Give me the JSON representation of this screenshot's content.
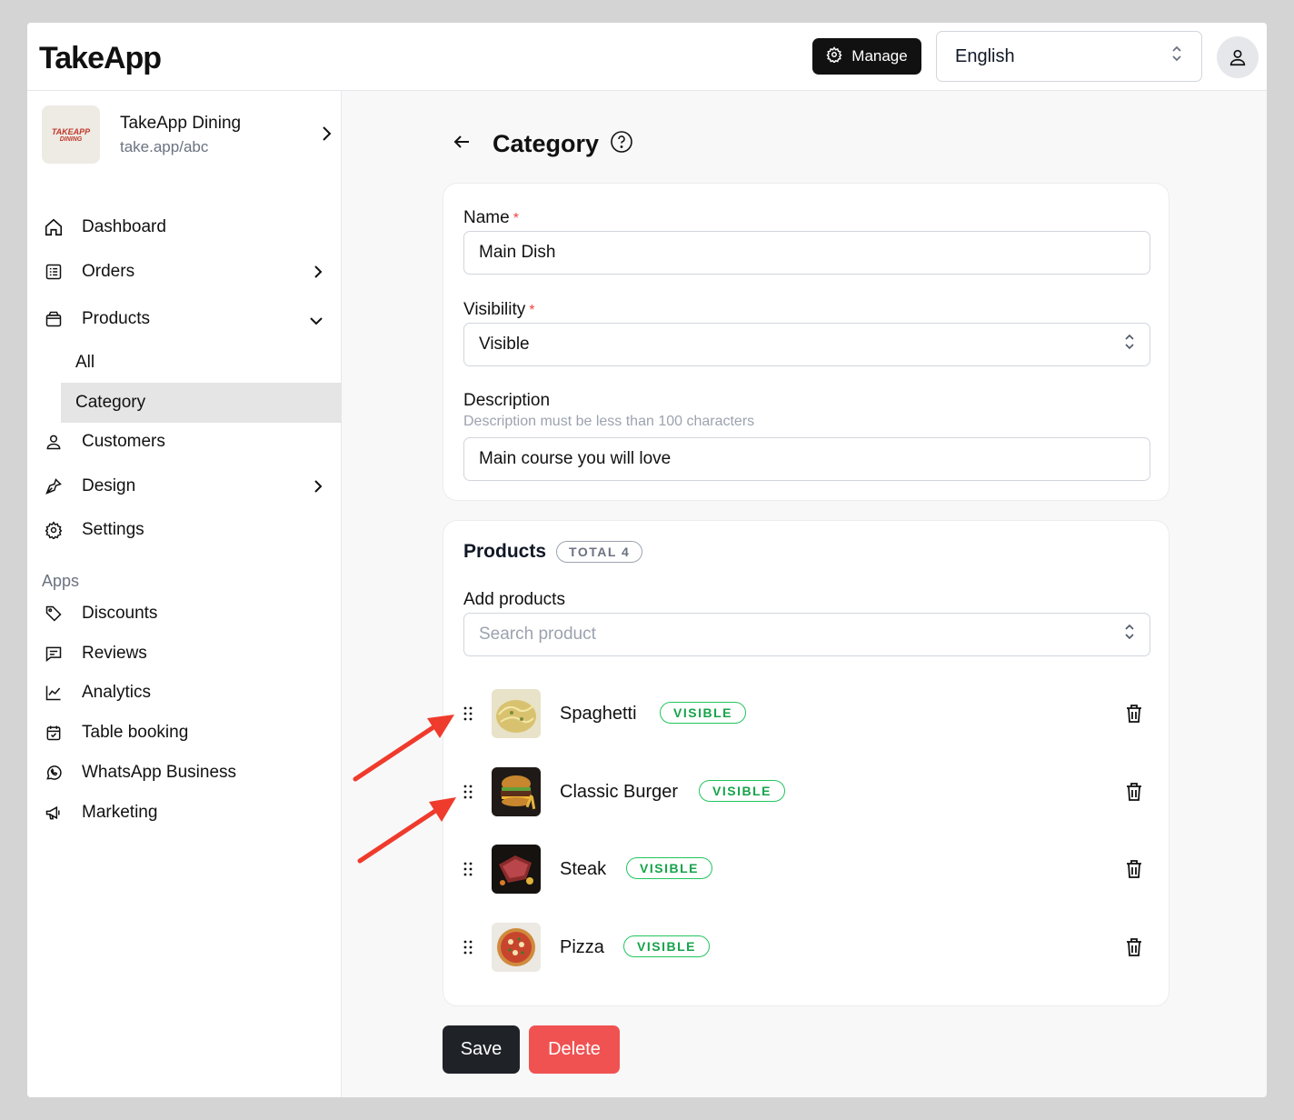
{
  "app": {
    "logo": "TakeApp"
  },
  "header": {
    "manage_label": "Manage",
    "language": "English"
  },
  "store": {
    "name": "TakeApp Dining",
    "url": "take.app/abc",
    "logo_line1": "TAKEAPP",
    "logo_line2": "DINING"
  },
  "sidebar": {
    "items": [
      {
        "label": "Dashboard",
        "icon": "home-icon"
      },
      {
        "label": "Orders",
        "icon": "list-icon"
      },
      {
        "label": "Products",
        "icon": "box-icon"
      },
      {
        "label": "Customers",
        "icon": "user-icon"
      },
      {
        "label": "Design",
        "icon": "pen-icon"
      },
      {
        "label": "Settings",
        "icon": "gear-icon"
      }
    ],
    "product_sub": [
      {
        "label": "All"
      },
      {
        "label": "Category"
      }
    ],
    "apps_label": "Apps",
    "apps": [
      {
        "label": "Discounts",
        "icon": "tag-icon"
      },
      {
        "label": "Reviews",
        "icon": "message-icon"
      },
      {
        "label": "Analytics",
        "icon": "chart-icon"
      },
      {
        "label": "Table booking",
        "icon": "calendar-icon"
      },
      {
        "label": "WhatsApp Business",
        "icon": "whatsapp-icon"
      },
      {
        "label": "Marketing",
        "icon": "megaphone-icon"
      }
    ]
  },
  "page": {
    "title": "Category"
  },
  "form": {
    "name_label": "Name",
    "name_value": "Main Dish",
    "visibility_label": "Visibility",
    "visibility_value": "Visible",
    "description_label": "Description",
    "description_hint": "Description must be less than 100 characters",
    "description_value": "Main course you will love",
    "required_mark": "*"
  },
  "products": {
    "title": "Products",
    "total_badge": "TOTAL 4",
    "add_label": "Add products",
    "search_placeholder": "Search product",
    "items": [
      {
        "name": "Spaghetti",
        "status": "VISIBLE"
      },
      {
        "name": "Classic Burger",
        "status": "VISIBLE"
      },
      {
        "name": "Steak",
        "status": "VISIBLE"
      },
      {
        "name": "Pizza",
        "status": "VISIBLE"
      }
    ]
  },
  "actions": {
    "save": "Save",
    "delete": "Delete"
  },
  "colors": {
    "accent_dark": "#111111",
    "danger": "#f05252",
    "success": "#16a34a",
    "annotation": "#ef3b2c"
  }
}
